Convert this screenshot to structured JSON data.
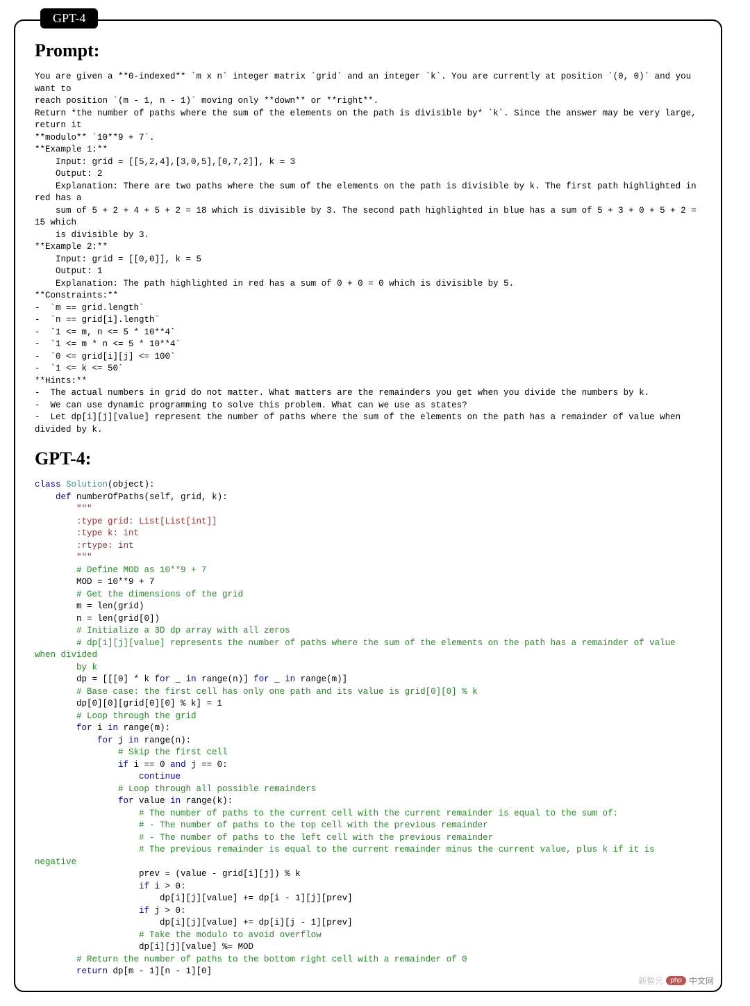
{
  "tag": "GPT-4",
  "watermark": {
    "brand": "php",
    "text": "中文网",
    "sub": "新智元"
  },
  "prompt": {
    "heading": "Prompt:",
    "intro_l1": "You are given a **0-indexed** `m x n` integer matrix `grid` and an integer `k`. You are currently at position `(0, 0)` and you want to",
    "intro_l2": "reach position `(m - 1, n - 1)` moving only **down** or **right**.",
    "intro_l3": "Return *the number of paths where the sum of the elements on the path is divisible by* `k`. Since the answer may be very large, return it",
    "intro_l4": "**modulo** `10**9 + 7`.",
    "ex1_h": "**Example 1:**",
    "ex1_in": "    Input: grid = [[5,2,4],[3,0,5],[0,7,2]], k = 3",
    "ex1_out": "    Output: 2",
    "ex1_exp1": "    Explanation: There are two paths where the sum of the elements on the path is divisible by k. The first path highlighted in red has a",
    "ex1_exp2": "    sum of 5 + 2 + 4 + 5 + 2 = 18 which is divisible by 3. The second path highlighted in blue has a sum of 5 + 3 + 0 + 5 + 2 = 15 which",
    "ex1_exp3": "    is divisible by 3.",
    "ex2_h": "**Example 2:**",
    "ex2_in": "    Input: grid = [[0,0]], k = 5",
    "ex2_out": "    Output: 1",
    "ex2_exp": "    Explanation: The path highlighted in red has a sum of 0 + 0 = 0 which is divisible by 5.",
    "con_h": "**Constraints:**",
    "con1": "-  `m == grid.length`",
    "con2": "-  `n == grid[i].length`",
    "con3": "-  `1 <= m, n <= 5 * 10**4`",
    "con4": "-  `1 <= m * n <= 5 * 10**4`",
    "con5": "-  `0 <= grid[i][j] <= 100`",
    "con6": "-  `1 <= k <= 50`",
    "hint_h": "**Hints:**",
    "hint1": "-  The actual numbers in grid do not matter. What matters are the remainders you get when you divide the numbers by k.",
    "hint2": "-  We can use dynamic programming to solve this problem. What can we use as states?",
    "hint3": "-  Let dp[i][j][value] represent the number of paths where the sum of the elements on the path has a remainder of value when divided by k."
  },
  "answer": {
    "heading": "GPT-4:",
    "tokens": [
      {
        "t": "class ",
        "c": "k-kw"
      },
      {
        "t": "Solution",
        "c": "k-cls"
      },
      {
        "t": "(object):",
        "c": "k-txt"
      },
      {
        "t": "\n"
      },
      {
        "t": "    ",
        "c": "k-txt"
      },
      {
        "t": "def ",
        "c": "k-kw"
      },
      {
        "t": "numberOfPaths(self, grid, k):",
        "c": "k-txt"
      },
      {
        "t": "\n"
      },
      {
        "t": "        \"\"\"",
        "c": "k-str"
      },
      {
        "t": "\n"
      },
      {
        "t": "        :type grid: List[List[int]]",
        "c": "k-str"
      },
      {
        "t": "\n"
      },
      {
        "t": "        :type k: int",
        "c": "k-str"
      },
      {
        "t": "\n"
      },
      {
        "t": "        :rtype: int",
        "c": "k-str"
      },
      {
        "t": "\n"
      },
      {
        "t": "        \"\"\"",
        "c": "k-str"
      },
      {
        "t": "\n"
      },
      {
        "t": "        # Define MOD as 10**9 + 7",
        "c": "k-com"
      },
      {
        "t": "\n"
      },
      {
        "t": "        MOD = 10**9 + 7",
        "c": "k-txt"
      },
      {
        "t": "\n"
      },
      {
        "t": "        # Get the dimensions of the grid",
        "c": "k-com"
      },
      {
        "t": "\n"
      },
      {
        "t": "        m = len(grid)",
        "c": "k-txt"
      },
      {
        "t": "\n"
      },
      {
        "t": "        n = len(grid[0])",
        "c": "k-txt"
      },
      {
        "t": "\n"
      },
      {
        "t": "        # Initialize a 3D dp array with all zeros",
        "c": "k-com"
      },
      {
        "t": "\n"
      },
      {
        "t": "        # dp[i][j][value] represents the number of paths where the sum of the elements on the path has a remainder of value when divided",
        "c": "k-com"
      },
      {
        "t": "\n"
      },
      {
        "t": "        by k",
        "c": "k-com"
      },
      {
        "t": "\n"
      },
      {
        "t": "        dp = [[[0] * k ",
        "c": "k-txt"
      },
      {
        "t": "for ",
        "c": "k-kw"
      },
      {
        "t": "_ ",
        "c": "k-txt"
      },
      {
        "t": "in ",
        "c": "k-kw"
      },
      {
        "t": "range(n)] ",
        "c": "k-txt"
      },
      {
        "t": "for ",
        "c": "k-kw"
      },
      {
        "t": "_ ",
        "c": "k-txt"
      },
      {
        "t": "in ",
        "c": "k-kw"
      },
      {
        "t": "range(m)]",
        "c": "k-txt"
      },
      {
        "t": "\n"
      },
      {
        "t": "        # Base case: the first cell has only one path and its value is grid[0][0] % k",
        "c": "k-com"
      },
      {
        "t": "\n"
      },
      {
        "t": "        dp[0][0][grid[0][0] % k] = 1",
        "c": "k-txt"
      },
      {
        "t": "\n"
      },
      {
        "t": "        # Loop through the grid",
        "c": "k-com"
      },
      {
        "t": "\n"
      },
      {
        "t": "        ",
        "c": "k-txt"
      },
      {
        "t": "for ",
        "c": "k-kw"
      },
      {
        "t": "i ",
        "c": "k-txt"
      },
      {
        "t": "in ",
        "c": "k-kw"
      },
      {
        "t": "range(m):",
        "c": "k-txt"
      },
      {
        "t": "\n"
      },
      {
        "t": "            ",
        "c": "k-txt"
      },
      {
        "t": "for ",
        "c": "k-kw"
      },
      {
        "t": "j ",
        "c": "k-txt"
      },
      {
        "t": "in ",
        "c": "k-kw"
      },
      {
        "t": "range(n):",
        "c": "k-txt"
      },
      {
        "t": "\n"
      },
      {
        "t": "                # Skip the first cell",
        "c": "k-com"
      },
      {
        "t": "\n"
      },
      {
        "t": "                ",
        "c": "k-txt"
      },
      {
        "t": "if ",
        "c": "k-kw"
      },
      {
        "t": "i == 0 ",
        "c": "k-txt"
      },
      {
        "t": "and ",
        "c": "k-kw"
      },
      {
        "t": "j == 0:",
        "c": "k-txt"
      },
      {
        "t": "\n"
      },
      {
        "t": "                    ",
        "c": "k-txt"
      },
      {
        "t": "continue",
        "c": "k-kw"
      },
      {
        "t": "\n"
      },
      {
        "t": "                # Loop through all possible remainders",
        "c": "k-com"
      },
      {
        "t": "\n"
      },
      {
        "t": "                ",
        "c": "k-txt"
      },
      {
        "t": "for ",
        "c": "k-kw"
      },
      {
        "t": "value ",
        "c": "k-txt"
      },
      {
        "t": "in ",
        "c": "k-kw"
      },
      {
        "t": "range(k):",
        "c": "k-txt"
      },
      {
        "t": "\n"
      },
      {
        "t": "                    # The number of paths to the current cell with the current remainder is equal to the sum of:",
        "c": "k-com"
      },
      {
        "t": "\n"
      },
      {
        "t": "                    # - The number of paths to the top cell with the previous remainder",
        "c": "k-com"
      },
      {
        "t": "\n"
      },
      {
        "t": "                    # - The number of paths to the left cell with the previous remainder",
        "c": "k-com"
      },
      {
        "t": "\n"
      },
      {
        "t": "                    # The previous remainder is equal to the current remainder minus the current value, plus k if it is negative",
        "c": "k-com"
      },
      {
        "t": "\n"
      },
      {
        "t": "                    prev = (value - grid[i][j]) % k",
        "c": "k-txt"
      },
      {
        "t": "\n"
      },
      {
        "t": "                    ",
        "c": "k-txt"
      },
      {
        "t": "if ",
        "c": "k-kw"
      },
      {
        "t": "i > 0:",
        "c": "k-txt"
      },
      {
        "t": "\n"
      },
      {
        "t": "                        dp[i][j][value] += dp[i - 1][j][prev]",
        "c": "k-txt"
      },
      {
        "t": "\n"
      },
      {
        "t": "                    ",
        "c": "k-txt"
      },
      {
        "t": "if ",
        "c": "k-kw"
      },
      {
        "t": "j > 0:",
        "c": "k-txt"
      },
      {
        "t": "\n"
      },
      {
        "t": "                        dp[i][j][value] += dp[i][j - 1][prev]",
        "c": "k-txt"
      },
      {
        "t": "\n"
      },
      {
        "t": "                    # Take the modulo to avoid overflow",
        "c": "k-com"
      },
      {
        "t": "\n"
      },
      {
        "t": "                    dp[i][j][value] %= MOD",
        "c": "k-txt"
      },
      {
        "t": "\n"
      },
      {
        "t": "        # Return the number of paths to the bottom right cell with a remainder of 0",
        "c": "k-com"
      },
      {
        "t": "\n"
      },
      {
        "t": "        ",
        "c": "k-txt"
      },
      {
        "t": "return ",
        "c": "k-kw"
      },
      {
        "t": "dp[m - 1][n - 1][0]",
        "c": "k-txt"
      }
    ]
  }
}
